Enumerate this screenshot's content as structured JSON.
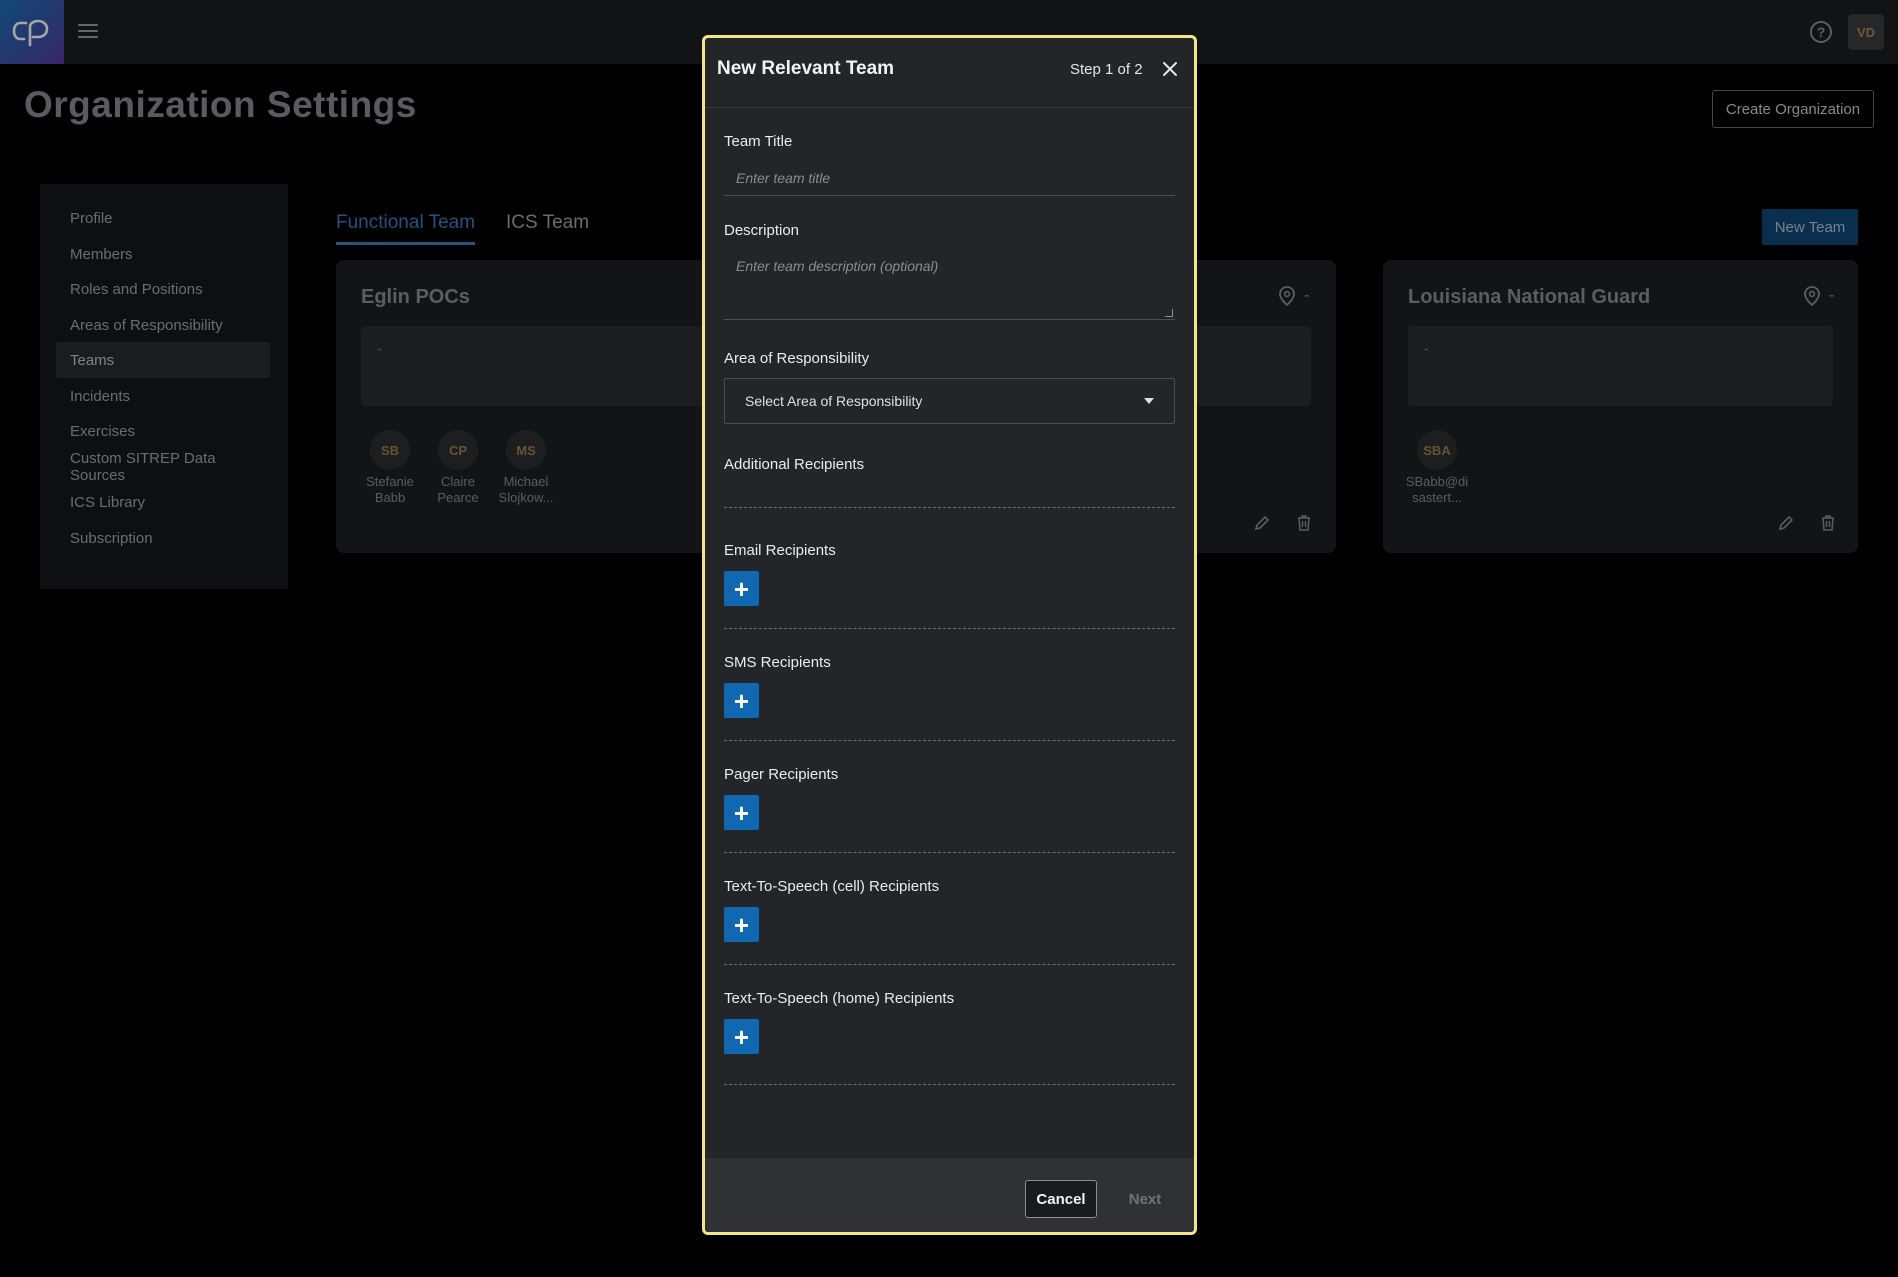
{
  "topbar": {
    "help_label": "?",
    "user_initials": "VD"
  },
  "page": {
    "title": "Organization Settings",
    "create_org_label": "Create Organization"
  },
  "sidebar": {
    "items": [
      {
        "label": "Profile"
      },
      {
        "label": "Members"
      },
      {
        "label": "Roles and Positions"
      },
      {
        "label": "Areas of Responsibility"
      },
      {
        "label": "Teams",
        "active": true
      },
      {
        "label": "Incidents"
      },
      {
        "label": "Exercises"
      },
      {
        "label": "Custom SITREP Data Sources"
      },
      {
        "label": "ICS Library"
      },
      {
        "label": "Subscription"
      }
    ]
  },
  "tabs": [
    {
      "label": "Functional Team",
      "active": true
    },
    {
      "label": "ICS Team",
      "active": false
    }
  ],
  "new_team_label": "New Team",
  "cards": [
    {
      "title": "Eglin POCs",
      "description": "-",
      "members": [
        {
          "initials": "SB",
          "name": "Stefanie Babb"
        },
        {
          "initials": "CP",
          "name": "Claire Pearce"
        },
        {
          "initials": "MS",
          "name": "Michael Slojkow..."
        }
      ]
    },
    {
      "title": "",
      "location": "-",
      "description": ""
    },
    {
      "title": "Louisiana National Guard",
      "location": "-",
      "description": "-",
      "members": [
        {
          "initials": "SBA",
          "name": "SBabb@disastert..."
        }
      ]
    }
  ],
  "modal": {
    "title": "New Relevant Team",
    "step": "Step 1 of 2",
    "team_title_label": "Team Title",
    "team_title_placeholder": "Enter team title",
    "description_label": "Description",
    "description_placeholder": "Enter team description (optional)",
    "aor_label": "Area of Responsibility",
    "aor_select_value": "Select Area of Responsibility",
    "additional_recipients_label": "Additional Recipients",
    "email_label": "Email Recipients",
    "sms_label": "SMS Recipients",
    "pager_label": "Pager Recipients",
    "tts_cell_label": "Text-To-Speech (cell) Recipients",
    "tts_home_label": "Text-To-Speech (home) Recipients",
    "add_symbol": "+",
    "cancel_label": "Cancel",
    "next_label": "Next"
  },
  "colors": {
    "accent": "#3a7ec4",
    "primary_button": "#0f68b0",
    "modal_border": "#f3e58a"
  }
}
